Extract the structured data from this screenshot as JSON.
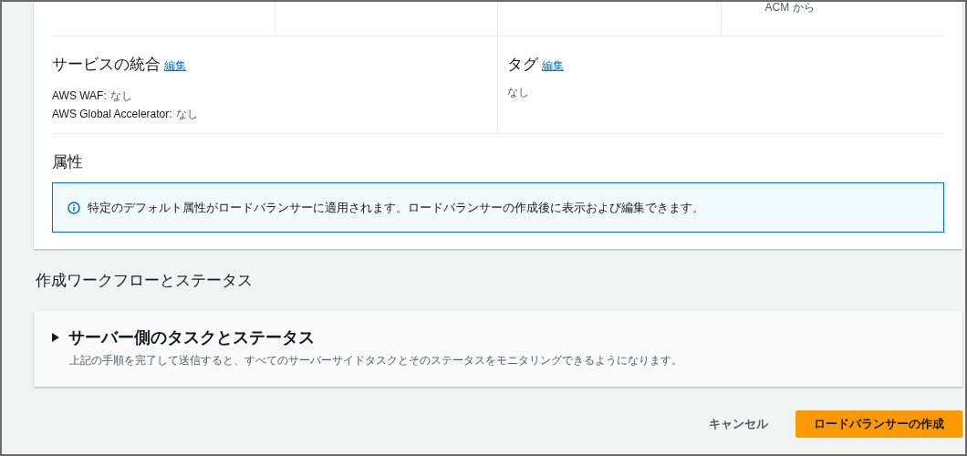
{
  "top_row": {
    "cells": [
      "",
      "",
      "",
      "ACM から"
    ]
  },
  "service_integration": {
    "title": "サービスの統合",
    "edit_link": "編集",
    "items": [
      {
        "label": "AWS WAF:",
        "value": "なし"
      },
      {
        "label": "AWS Global Accelerator:",
        "value": "なし"
      }
    ]
  },
  "tags": {
    "title": "タグ",
    "edit_link": "編集",
    "value": "なし"
  },
  "attributes": {
    "title": "属性",
    "info": "特定のデフォルト属性がロードバランサーに適用されます。ロードバランサーの作成後に表示および編集できます。"
  },
  "workflow": {
    "title": "作成ワークフローとステータス",
    "section": {
      "title": "サーバー側のタスクとステータス",
      "expanded": false,
      "description": "上記の手順を完了して送信すると、すべてのサーバーサイドタスクとそのステータスをモニタリングできるようになります。"
    }
  },
  "buttons": [
    {
      "kind": "secondary",
      "label": "キャンセル"
    },
    {
      "kind": "primary",
      "label": "ロードバランサーの作成"
    }
  ]
}
